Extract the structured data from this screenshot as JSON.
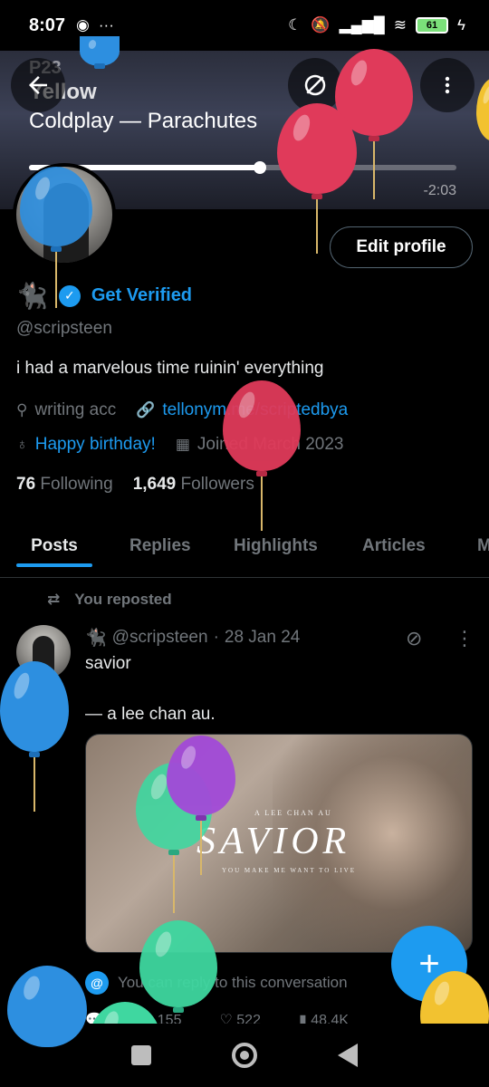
{
  "status_bar": {
    "time": "8:07",
    "battery": "61"
  },
  "banner": {
    "artist_line": "P23",
    "song": "Yellow",
    "album": "Coldplay — Parachutes",
    "remaining": "-2:03",
    "progress": 0.54
  },
  "header_buttons": {
    "back_icon": "back-arrow-icon",
    "grok_icon": "grok-icon",
    "search_icon": "search-icon",
    "more_icon": "more-vertical-icon"
  },
  "profile": {
    "edit_label": "Edit profile",
    "emoji": "🐈‍⬛",
    "get_verified": "Get Verified",
    "handle": "@scripsteen",
    "bio": "i had a marvelous time ruinin' everything",
    "location": "writing acc",
    "website": "tellonym.me/scriptedbya",
    "birthday": "Happy birthday!",
    "joined": "Joined March 2023",
    "following_count": "76",
    "following_label": "Following",
    "followers_count": "1,649",
    "followers_label": "Followers"
  },
  "tabs": [
    "Posts",
    "Replies",
    "Highlights",
    "Articles",
    "M"
  ],
  "post": {
    "repost_label": "You reposted",
    "emoji": "🐈‍⬛",
    "handle": "@scripsteen",
    "separator": "·",
    "date": "28 Jan 24",
    "line1": "savior",
    "line2": "— a lee chan au.",
    "media": {
      "top_text": "A LEE CHAN AU",
      "title": "SAVIOR",
      "subtitle": "YOU MAKE ME WANT TO LIVE"
    },
    "reply_note": "You can reply to this conversation",
    "reposts": "155",
    "likes": "522",
    "views": "48.4K"
  },
  "fab_label": "+"
}
